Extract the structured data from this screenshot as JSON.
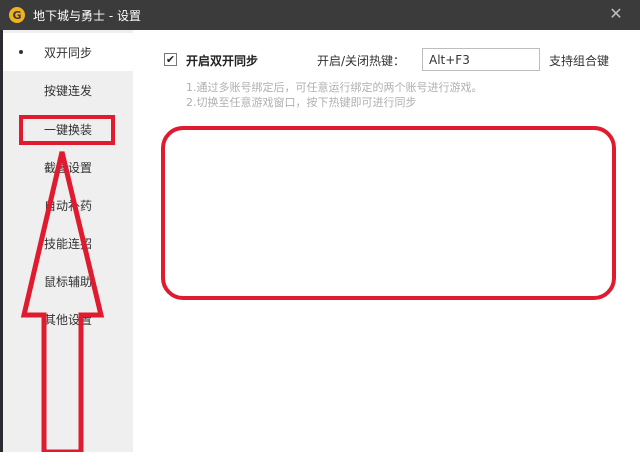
{
  "window": {
    "title": "地下城与勇士 - 设置",
    "logo_glyph": "G",
    "close_glyph": "✕"
  },
  "sidebar": {
    "items": [
      {
        "label": "双开同步"
      },
      {
        "label": "按键连发"
      },
      {
        "label": "一键换装"
      },
      {
        "label": "截图设置"
      },
      {
        "label": "自动补药"
      },
      {
        "label": "技能连招"
      },
      {
        "label": "鼠标辅助"
      },
      {
        "label": "其他设置"
      }
    ]
  },
  "main": {
    "sync_checkbox_checked": true,
    "checkmark_glyph": "✔",
    "sync_label": "开启双开同步",
    "hotkey_label": "开启/关闭热键：",
    "hotkey_value": "Alt+F3",
    "combo_label": "支持组合键",
    "hints": [
      "1.通过多账号绑定后，可任意运行绑定的两个账号进行游戏。",
      "2.切换至任意游戏窗口，按下热键即可进行同步"
    ]
  },
  "colors": {
    "annotation": "#e01b2f",
    "titlebar": "#3b3b3b",
    "sidebar": "#efefef"
  }
}
